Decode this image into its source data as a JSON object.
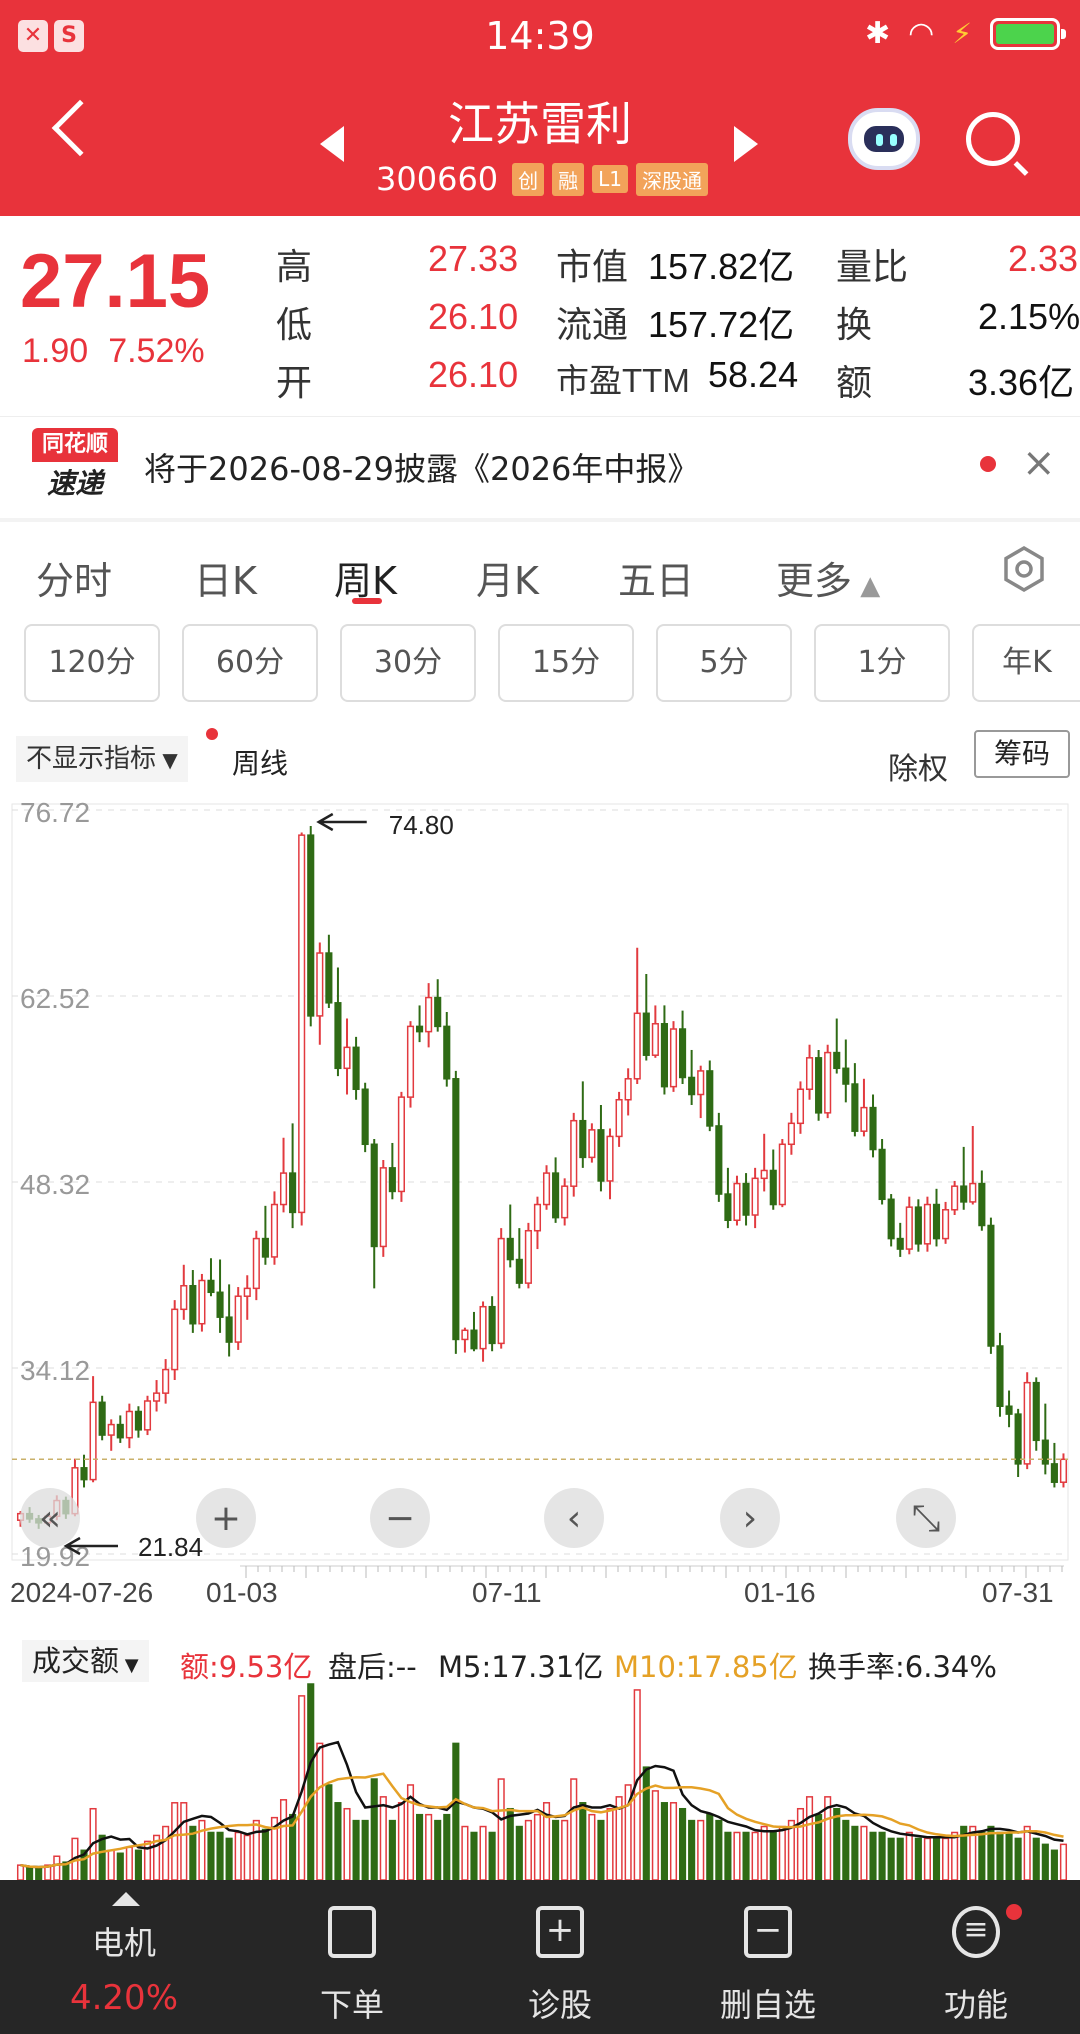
{
  "status_bar": {
    "time": "14:39"
  },
  "header": {
    "stock_name": "江苏雷利",
    "stock_code": "300660",
    "tags": [
      "创",
      "融",
      "L1",
      "深股通"
    ]
  },
  "quote": {
    "price": "27.15",
    "change": "1.90",
    "change_pct": "7.52%",
    "high_label": "高",
    "high": "27.33",
    "low_label": "低",
    "low": "26.10",
    "open_label": "开",
    "open": "26.10",
    "mcap_label": "市值",
    "mcap": "157.82亿",
    "float_label": "流通",
    "float": "157.72亿",
    "pe_label": "市盈TTM",
    "pe": "58.24",
    "vr_label": "量比",
    "vr": "2.33",
    "turnover_label": "换",
    "turnover": "2.15%",
    "amount_label": "额",
    "amount": "3.36亿"
  },
  "notice": {
    "logo_top": "同花顺",
    "logo_bottom": "速递",
    "text": "将于2026-08-29披露《2026年中报》"
  },
  "tabs": [
    "分时",
    "日K",
    "周K",
    "月K",
    "五日",
    "更多"
  ],
  "active_tab": "周K",
  "periods": [
    "120分",
    "60分",
    "30分",
    "15分",
    "5分",
    "1分",
    "年K"
  ],
  "controls": {
    "indicator": "不显示指标",
    "line_type": "周线",
    "adjust": "除权",
    "chips": "筹码"
  },
  "chart_data": {
    "type": "candlestick",
    "y_ticks": [
      "76.72",
      "62.52",
      "48.32",
      "34.12",
      "19.92"
    ],
    "ylim": [
      19.92,
      76.72
    ],
    "x_ticks": [
      "2024-07-26",
      "01-03",
      "07-11",
      "01-16",
      "07-31"
    ],
    "max_label": "74.80",
    "min_label": "21.84",
    "current_price": 27.15,
    "candles": [
      [
        22.5,
        23.2,
        22.0,
        23.0
      ],
      [
        23.0,
        23.5,
        22.3,
        22.6
      ],
      [
        22.6,
        22.9,
        21.84,
        22.3
      ],
      [
        22.3,
        23.0,
        22.1,
        22.8
      ],
      [
        22.8,
        24.4,
        22.5,
        24.0
      ],
      [
        24.0,
        24.3,
        22.6,
        23.0
      ],
      [
        23.0,
        27.2,
        22.8,
        26.5
      ],
      [
        26.5,
        27.5,
        25.0,
        25.6
      ],
      [
        25.6,
        33.5,
        25.4,
        31.5
      ],
      [
        31.5,
        32.0,
        28.6,
        29.0
      ],
      [
        29.0,
        30.2,
        27.8,
        29.8
      ],
      [
        29.8,
        30.5,
        28.4,
        28.8
      ],
      [
        28.8,
        31.4,
        28.0,
        30.8
      ],
      [
        30.8,
        31.2,
        28.8,
        29.4
      ],
      [
        29.4,
        32.0,
        29.0,
        31.6
      ],
      [
        31.6,
        33.2,
        30.8,
        32.2
      ],
      [
        32.2,
        34.8,
        31.4,
        34.0
      ],
      [
        34.0,
        39.3,
        33.2,
        38.6
      ],
      [
        38.6,
        42.0,
        37.8,
        40.4
      ],
      [
        40.4,
        41.6,
        36.8,
        37.5
      ],
      [
        37.5,
        41.3,
        36.9,
        40.8
      ],
      [
        40.8,
        42.5,
        39.6,
        39.9
      ],
      [
        39.9,
        42.4,
        36.8,
        38.0
      ],
      [
        38.0,
        40.5,
        35.0,
        36.1
      ],
      [
        36.1,
        40.3,
        35.5,
        39.6
      ],
      [
        39.6,
        41.2,
        37.8,
        40.2
      ],
      [
        40.2,
        44.6,
        39.3,
        44.0
      ],
      [
        44.0,
        46.5,
        42.0,
        42.6
      ],
      [
        42.6,
        47.6,
        42.0,
        46.6
      ],
      [
        46.6,
        51.7,
        46.0,
        49.0
      ],
      [
        49.0,
        52.8,
        44.8,
        46.0
      ],
      [
        46.0,
        75.0,
        45.0,
        74.8
      ],
      [
        74.8,
        75.5,
        60.2,
        61.0
      ],
      [
        61.0,
        66.6,
        58.8,
        65.8
      ],
      [
        65.8,
        67.2,
        61.6,
        62.0
      ],
      [
        62.0,
        64.7,
        56.4,
        57.0
      ],
      [
        57.0,
        60.8,
        55.0,
        58.6
      ],
      [
        58.6,
        59.4,
        54.6,
        55.4
      ],
      [
        55.4,
        55.9,
        50.6,
        51.2
      ],
      [
        51.2,
        51.6,
        40.2,
        43.4
      ],
      [
        43.4,
        50.0,
        42.6,
        49.4
      ],
      [
        49.4,
        51.3,
        47.0,
        47.6
      ],
      [
        47.6,
        55.2,
        46.8,
        54.8
      ],
      [
        54.8,
        60.6,
        54.0,
        60.2
      ],
      [
        60.2,
        61.8,
        59.0,
        59.8
      ],
      [
        59.8,
        63.5,
        58.6,
        62.4
      ],
      [
        62.4,
        63.8,
        59.8,
        60.2
      ],
      [
        60.2,
        61.3,
        55.6,
        56.2
      ],
      [
        56.2,
        56.8,
        35.2,
        36.3
      ],
      [
        36.3,
        37.2,
        35.3,
        37.0
      ],
      [
        37.0,
        38.4,
        35.4,
        35.6
      ],
      [
        35.6,
        39.2,
        34.6,
        38.8
      ],
      [
        38.8,
        39.6,
        35.4,
        36.0
      ],
      [
        36.0,
        44.8,
        35.6,
        44.0
      ],
      [
        44.0,
        46.6,
        41.8,
        42.4
      ],
      [
        42.4,
        44.8,
        40.2,
        40.6
      ],
      [
        40.6,
        45.2,
        40.2,
        44.6
      ],
      [
        44.6,
        47.2,
        43.2,
        46.6
      ],
      [
        46.6,
        49.6,
        46.2,
        49.0
      ],
      [
        49.0,
        50.2,
        45.2,
        45.6
      ],
      [
        45.6,
        48.6,
        45.0,
        48.0
      ],
      [
        48.0,
        53.6,
        47.2,
        53.0
      ],
      [
        53.0,
        56.0,
        49.4,
        50.2
      ],
      [
        50.2,
        52.8,
        49.8,
        52.3
      ],
      [
        52.3,
        54.2,
        47.6,
        48.4
      ],
      [
        48.4,
        52.4,
        47.0,
        51.8
      ],
      [
        51.8,
        55.2,
        51.0,
        54.6
      ],
      [
        54.6,
        57.0,
        53.4,
        56.2
      ],
      [
        56.2,
        66.2,
        55.8,
        61.2
      ],
      [
        61.2,
        64.2,
        57.6,
        58.0
      ],
      [
        58.0,
        61.8,
        57.8,
        60.4
      ],
      [
        60.4,
        61.8,
        55.0,
        55.6
      ],
      [
        55.6,
        60.6,
        55.2,
        60.0
      ],
      [
        60.0,
        61.4,
        55.8,
        56.3
      ],
      [
        56.3,
        58.4,
        54.2,
        55.0
      ],
      [
        55.0,
        57.2,
        53.2,
        56.8
      ],
      [
        56.8,
        57.6,
        52.2,
        52.6
      ],
      [
        52.6,
        53.6,
        46.8,
        47.4
      ],
      [
        47.4,
        49.4,
        44.8,
        45.4
      ],
      [
        45.4,
        48.8,
        45.0,
        48.2
      ],
      [
        48.2,
        49.0,
        45.0,
        45.8
      ],
      [
        45.8,
        49.4,
        44.8,
        48.6
      ],
      [
        48.6,
        52.0,
        47.6,
        49.2
      ],
      [
        49.2,
        50.8,
        46.2,
        46.6
      ],
      [
        46.6,
        51.6,
        46.4,
        51.2
      ],
      [
        51.2,
        53.6,
        50.4,
        52.8
      ],
      [
        52.8,
        56.0,
        52.0,
        55.4
      ],
      [
        55.4,
        58.8,
        54.6,
        57.8
      ],
      [
        57.8,
        58.4,
        53.0,
        53.6
      ],
      [
        53.6,
        58.8,
        53.2,
        58.2
      ],
      [
        58.2,
        60.8,
        56.6,
        57.0
      ],
      [
        57.0,
        59.2,
        54.4,
        55.8
      ],
      [
        55.8,
        57.4,
        51.8,
        52.2
      ],
      [
        52.2,
        56.2,
        51.8,
        54.0
      ],
      [
        54.0,
        55.0,
        50.2,
        50.8
      ],
      [
        50.8,
        51.6,
        46.6,
        47.0
      ],
      [
        47.0,
        47.4,
        43.4,
        44.0
      ],
      [
        44.0,
        45.2,
        42.6,
        43.2
      ],
      [
        43.2,
        47.2,
        42.8,
        46.4
      ],
      [
        46.4,
        47.0,
        43.0,
        43.6
      ],
      [
        43.6,
        47.2,
        43.0,
        46.6
      ],
      [
        46.6,
        47.8,
        43.4,
        44.0
      ],
      [
        44.0,
        46.8,
        43.6,
        46.2
      ],
      [
        46.2,
        48.4,
        45.8,
        48.0
      ],
      [
        48.0,
        51.0,
        46.2,
        46.8
      ],
      [
        46.8,
        52.6,
        46.6,
        48.2
      ],
      [
        48.2,
        49.2,
        44.6,
        45.0
      ],
      [
        45.0,
        45.6,
        35.2,
        35.8
      ],
      [
        35.8,
        36.8,
        30.4,
        31.2
      ],
      [
        31.2,
        32.4,
        29.6,
        30.6
      ],
      [
        30.6,
        31.0,
        25.8,
        26.8
      ],
      [
        26.8,
        33.8,
        26.4,
        33.0
      ],
      [
        33.0,
        33.4,
        27.8,
        28.6
      ],
      [
        28.6,
        31.4,
        26.0,
        26.8
      ],
      [
        26.8,
        28.4,
        25.0,
        25.4
      ],
      [
        25.4,
        27.6,
        25.0,
        27.15
      ]
    ]
  },
  "volume": {
    "selector": "成交额",
    "amount": "额:9.53亿",
    "after_hours": "盘后:--",
    "m5": "M5:17.31亿",
    "m10": "M10:17.85亿",
    "turnover": "换手率:6.34%",
    "values": [
      0.5,
      0.4,
      0.4,
      0.5,
      0.8,
      0.6,
      1.4,
      1.0,
      2.4,
      1.5,
      1.0,
      0.9,
      1.1,
      1.0,
      1.3,
      1.5,
      1.8,
      2.6,
      2.6,
      1.8,
      2.0,
      1.6,
      1.6,
      1.4,
      1.6,
      1.5,
      2.0,
      1.7,
      2.1,
      2.7,
      2.2,
      6.2,
      6.6,
      4.6,
      3.2,
      2.6,
      2.4,
      2.0,
      2.0,
      3.4,
      2.8,
      2.0,
      2.6,
      3.2,
      2.2,
      2.2,
      2.0,
      2.2,
      4.6,
      1.8,
      1.6,
      1.8,
      1.6,
      3.4,
      2.4,
      1.8,
      2.0,
      2.2,
      2.6,
      2.0,
      2.0,
      3.4,
      2.6,
      2.2,
      2.0,
      2.4,
      2.8,
      3.2,
      6.4,
      3.8,
      3.0,
      2.6,
      2.6,
      2.4,
      2.0,
      2.0,
      2.2,
      2.0,
      1.6,
      1.6,
      1.6,
      1.6,
      1.8,
      1.6,
      1.8,
      2.0,
      2.4,
      2.8,
      2.2,
      2.8,
      2.4,
      2.0,
      1.8,
      1.8,
      1.6,
      1.6,
      1.4,
      1.4,
      1.6,
      1.4,
      1.4,
      1.4,
      1.4,
      1.6,
      1.8,
      1.8,
      1.6,
      1.8,
      1.6,
      1.6,
      1.4,
      1.8,
      1.4,
      1.2,
      1.0,
      1.2
    ]
  },
  "bottom_nav": {
    "sector_name": "电机",
    "sector_change": "4.20%",
    "items": [
      "下单",
      "诊股",
      "删自选",
      "功能"
    ]
  }
}
